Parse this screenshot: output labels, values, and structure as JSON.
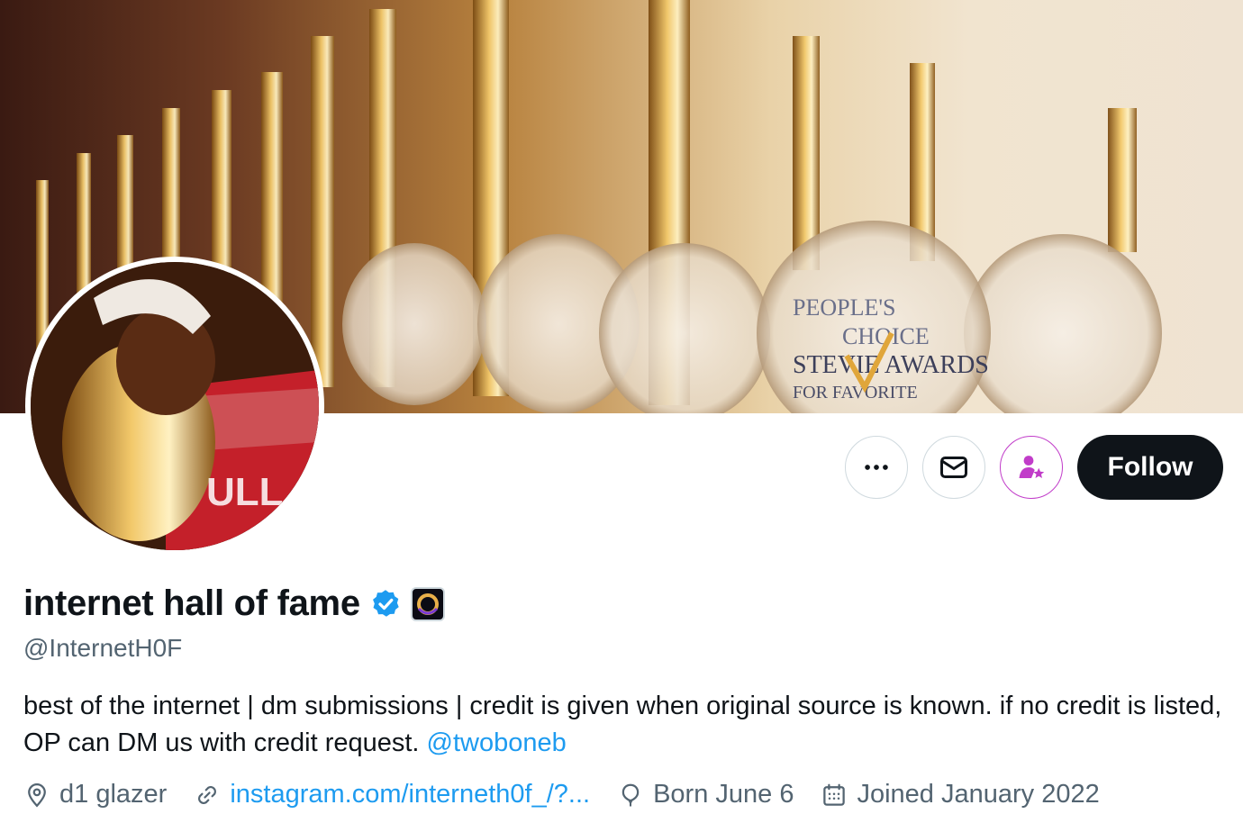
{
  "banner": {
    "alt_description": ""
  },
  "actions": {
    "more_label": "•••",
    "follow_label": "Follow"
  },
  "profile": {
    "display_name": "internet hall of fame",
    "handle": "@InternetH0F",
    "bio_text": "best of the internet | dm submissions | credit is given when original source is known. if no credit is listed, OP can DM us with credit request. ",
    "bio_mention": "@twoboneb",
    "location": "d1 glazer",
    "website": "instagram.com/interneth0f_/?...",
    "birthday": "Born June 6",
    "joined": "Joined January 2022"
  },
  "colors": {
    "accent": "#1d9bf0",
    "verified": "#1d9bf0",
    "subscribe": "#c13cc9",
    "follow_bg": "#0f1419"
  },
  "icons": {
    "more": "more-horizontal-icon",
    "message": "envelope-icon",
    "subscribe": "person-star-icon",
    "verified": "verified-badge-icon",
    "affiliate": "affiliate-badge-icon",
    "location": "location-pin-icon",
    "link": "link-icon",
    "birthday": "balloon-icon",
    "calendar": "calendar-icon"
  }
}
